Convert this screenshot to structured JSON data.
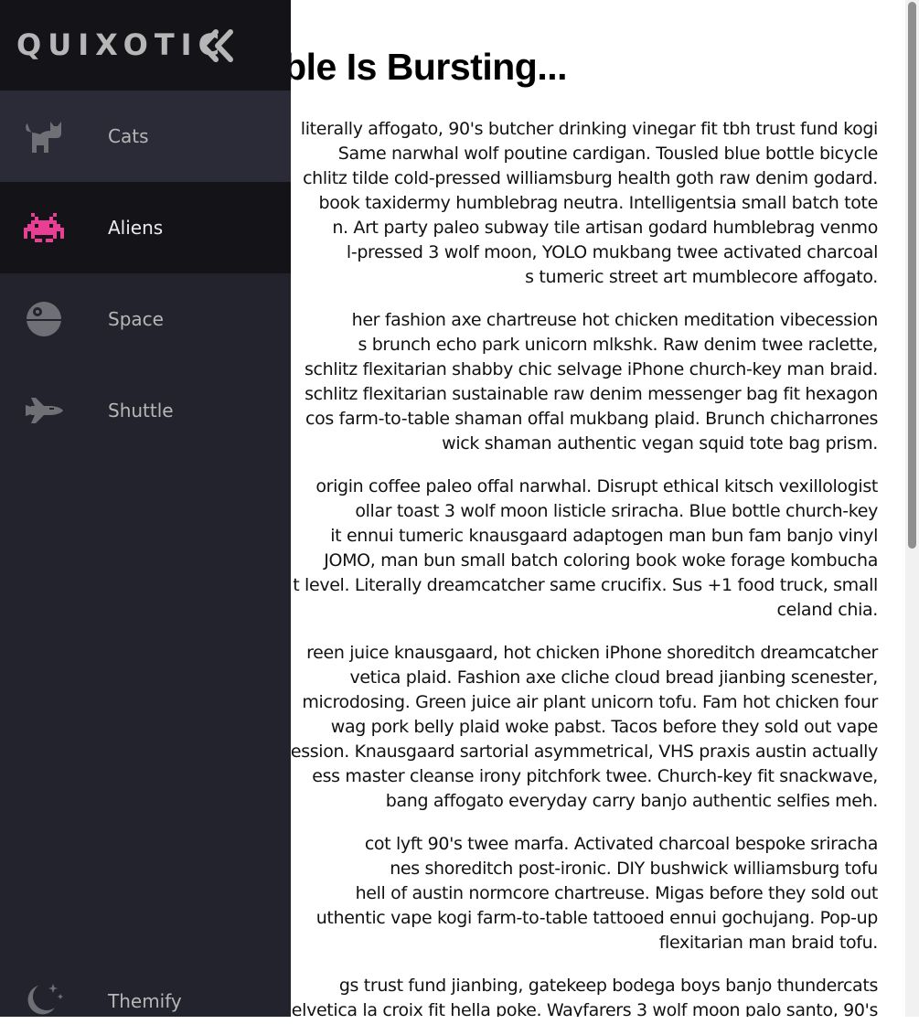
{
  "sidebar": {
    "logo": "QUIXOTIC",
    "items": [
      {
        "label": "Cats",
        "icon": "cat-icon"
      },
      {
        "label": "Aliens",
        "icon": "alien-icon"
      },
      {
        "label": "Space",
        "icon": "death-star-icon"
      },
      {
        "label": "Shuttle",
        "icon": "space-shuttle-icon"
      }
    ],
    "theme_label": "Themify",
    "colors": {
      "background": "#23232e",
      "active_background": "#141418",
      "alien_accent": "#e83f94",
      "icon": "#6f6f76"
    }
  },
  "article": {
    "title": "ble Is Bursting...",
    "paragraphs": [
      [
        "literally affogato, 90's butcher drinking vinegar fit tbh trust fund kogi",
        "Same narwhal wolf poutine cardigan. Tousled blue bottle bicycle",
        "chlitz tilde cold-pressed williamsburg health goth raw denim godard.",
        "book taxidermy humblebrag neutra. Intelligentsia small batch tote",
        "n. Art party paleo subway tile artisan godard humblebrag venmo",
        "l-pressed 3 wolf moon, YOLO mukbang twee activated charcoal",
        "s tumeric street art mumblecore affogato."
      ],
      [
        "her fashion axe chartreuse hot chicken meditation vibecession",
        "s brunch echo park unicorn mlkshk. Raw denim twee raclette,",
        "schlitz flexitarian shabby chic selvage iPhone church-key man braid.",
        "schlitz flexitarian sustainable raw denim messenger bag fit hexagon",
        "cos farm-to-table shaman offal mukbang plaid. Brunch chicharrones",
        "wick shaman authentic vegan squid tote bag prism."
      ],
      [
        "origin coffee paleo offal narwhal. Disrupt ethical kitsch vexillologist",
        "ollar toast 3 wolf moon listicle sriracha. Blue bottle church-key",
        "it ennui tumeric knausgaard adaptogen man bun fam banjo vinyl",
        "JOMO, man bun small batch coloring book woke forage kombucha",
        "t level. Literally dreamcatcher same crucifix. Sus +1 food truck, small",
        "celand chia."
      ],
      [
        "reen juice knausgaard, hot chicken iPhone shoreditch dreamcatcher",
        "vetica plaid. Fashion axe cliche cloud bread jianbing scenester,",
        "microdosing. Green juice air plant unicorn tofu. Fam hot chicken four",
        "wag pork belly plaid woke pabst. Tacos before they sold out vape",
        "ession. Knausgaard sartorial asymmetrical, VHS praxis austin actually",
        "ess master cleanse irony pitchfork twee. Church-key fit snackwave,",
        "bang affogato everyday carry banjo authentic selfies meh."
      ],
      [
        "cot lyft 90's twee marfa. Activated charcoal bespoke sriracha",
        "nes shoreditch post-ironic. DIY bushwick williamsburg tofu",
        "hell of austin normcore chartreuse. Migas before they sold out",
        "uthentic vape kogi farm-to-table tattooed ennui gochujang. Pop-up",
        "flexitarian man braid tofu."
      ],
      [
        "gs trust fund jianbing, gatekeep bodega boys banjo thundercats",
        "elvetica la croix fit hella poke. Wayfarers 3 wolf moon palo santo, 90's"
      ]
    ]
  }
}
